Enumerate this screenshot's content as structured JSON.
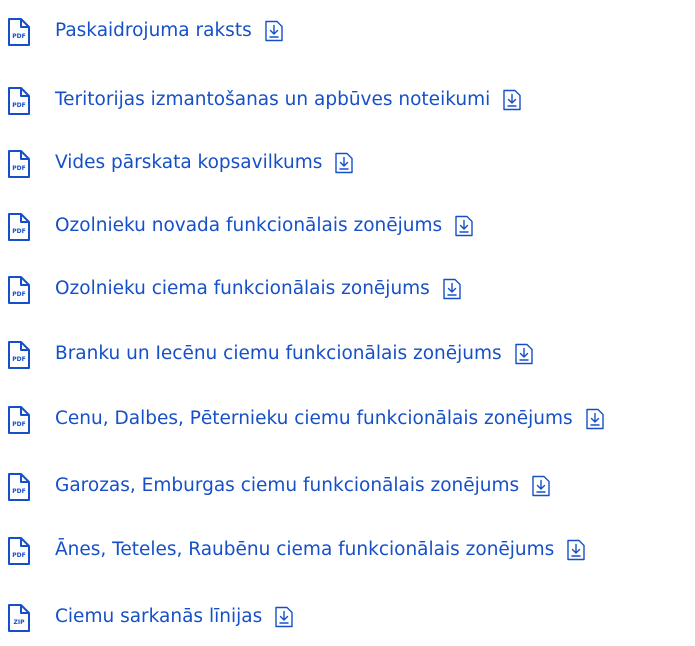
{
  "files": [
    {
      "label": "Paskaidrojuma raksts",
      "type": "PDF",
      "icon": "pdf-file-icon"
    },
    {
      "label": "Teritorijas izmantošanas un apbūves noteikumi",
      "type": "PDF",
      "icon": "pdf-file-icon"
    },
    {
      "label": "Vides pārskata kopsavilkums",
      "type": "PDF",
      "icon": "pdf-file-icon"
    },
    {
      "label": "Ozolnieku novada funkcionālais zonējums",
      "type": "PDF",
      "icon": "pdf-file-icon"
    },
    {
      "label": "Ozolnieku ciema funkcionālais zonējums",
      "type": "PDF",
      "icon": "pdf-file-icon"
    },
    {
      "label": "Branku un Iecēnu ciemu funkcionālais zonējums",
      "type": "PDF",
      "icon": "pdf-file-icon"
    },
    {
      "label": "Cenu, Dalbes, Pēternieku ciemu funkcionālais zonējums",
      "type": "PDF",
      "icon": "pdf-file-icon"
    },
    {
      "label": "Garozas, Emburgas ciemu funkcionālais zonējums",
      "type": "PDF",
      "icon": "pdf-file-icon"
    },
    {
      "label": "Ānes, Teteles, Raubēnu ciema funkcionālais zonējums",
      "type": "PDF",
      "icon": "pdf-file-icon"
    },
    {
      "label": "Ciemu sarkanās līnijas",
      "type": "ZIP",
      "icon": "zip-file-icon"
    }
  ],
  "colors": {
    "link": "#1650c8",
    "icon": "#1650c8"
  },
  "download_icon": "download-icon"
}
